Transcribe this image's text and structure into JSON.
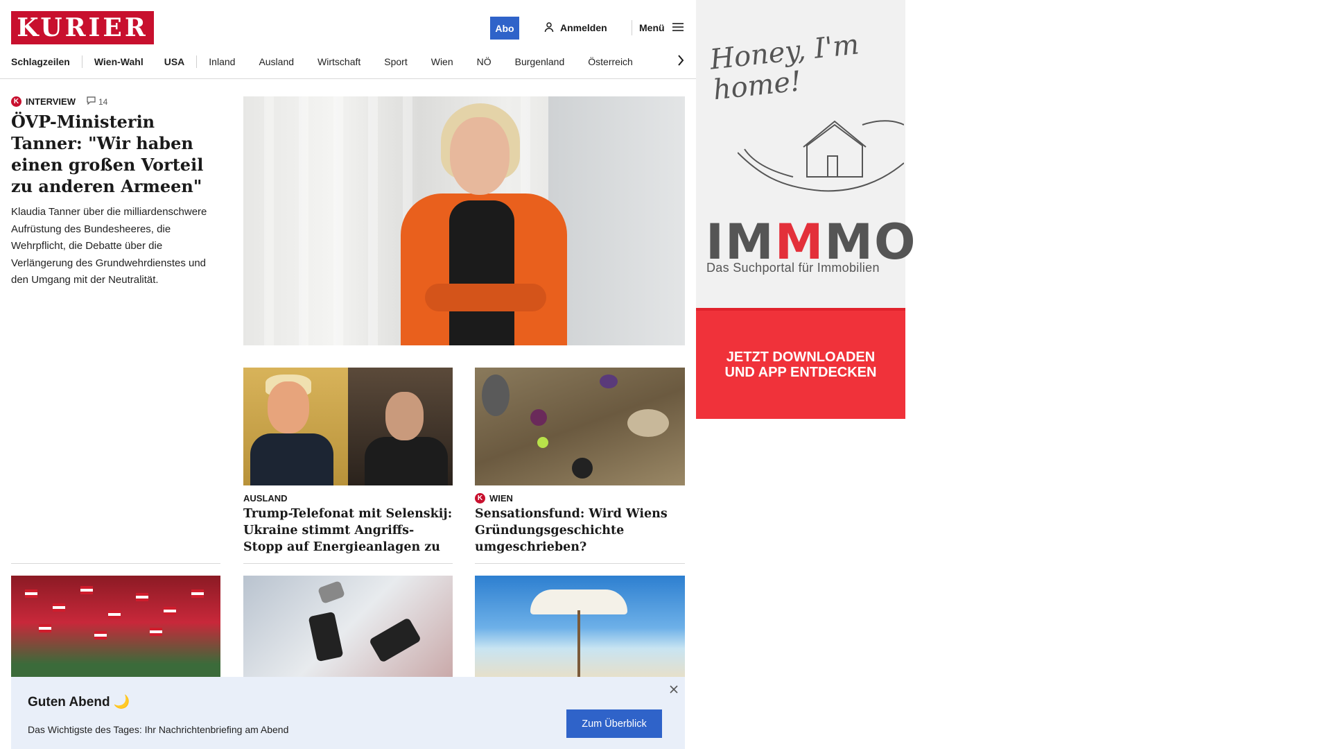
{
  "header": {
    "logo": "KURIER",
    "abo_label": "Abo",
    "login_label": "Anmelden",
    "menu_label": "Menü",
    "nav": [
      {
        "label": "Schlagzeilen",
        "bold": true
      },
      {
        "label": "Wien-Wahl",
        "bold": true
      },
      {
        "label": "USA",
        "bold": true
      },
      {
        "label": "Inland",
        "bold": false
      },
      {
        "label": "Ausland",
        "bold": false
      },
      {
        "label": "Wirtschaft",
        "bold": false
      },
      {
        "label": "Sport",
        "bold": false
      },
      {
        "label": "Wien",
        "bold": false
      },
      {
        "label": "NÖ",
        "bold": false
      },
      {
        "label": "Burgenland",
        "bold": false
      },
      {
        "label": "Österreich",
        "bold": false
      }
    ]
  },
  "lead": {
    "kicker": "INTERVIEW",
    "badge": "K",
    "comments": "14",
    "title": "ÖVP-Ministerin Tanner: \"Wir haben einen großen Vorteil zu anderen Armeen\"",
    "teaser": "Klaudia Tanner über die milliardenschwere Aufrüstung des Bundesheeres, die Wehrpflicht, die Debatte über die Verlängerung des Grundwehrdienstes und den Umgang mit der Neutralität."
  },
  "stories": [
    {
      "kicker": "AUSLAND",
      "title": "Trump-Telefonat mit Selenskij: Ukraine stimmt Angriffs-Stopp auf Energieanlagen zu"
    },
    {
      "kicker": "WIEN",
      "badge": "K",
      "title": "Sensationsfund: Wird Wiens Gründungsgeschichte umgeschrieben?"
    }
  ],
  "ad": {
    "script": "Honey, I'm home!",
    "brand_part1": "IM",
    "brand_part2": "M",
    "brand_part3": "MO",
    "tagline": "Das Suchportal für Immobilien",
    "cta_line1": "JETZT DOWNLOADEN",
    "cta_line2": "UND APP ENTDECKEN"
  },
  "briefing": {
    "title": "Guten Abend 🌙",
    "text": "Das Wichtigste des Tages: Ihr Nachrichtenbriefing am Abend",
    "button": "Zum Überblick"
  },
  "icons": {
    "user": "user-icon",
    "menu": "hamburger-icon",
    "chevron": "chevron-right-icon",
    "comment": "comment-icon",
    "close": "close-icon"
  },
  "colors": {
    "brand_red": "#c8102e",
    "button_blue": "#2f63c9",
    "ad_red": "#f0323a",
    "briefing_bg": "#e9eff9"
  }
}
